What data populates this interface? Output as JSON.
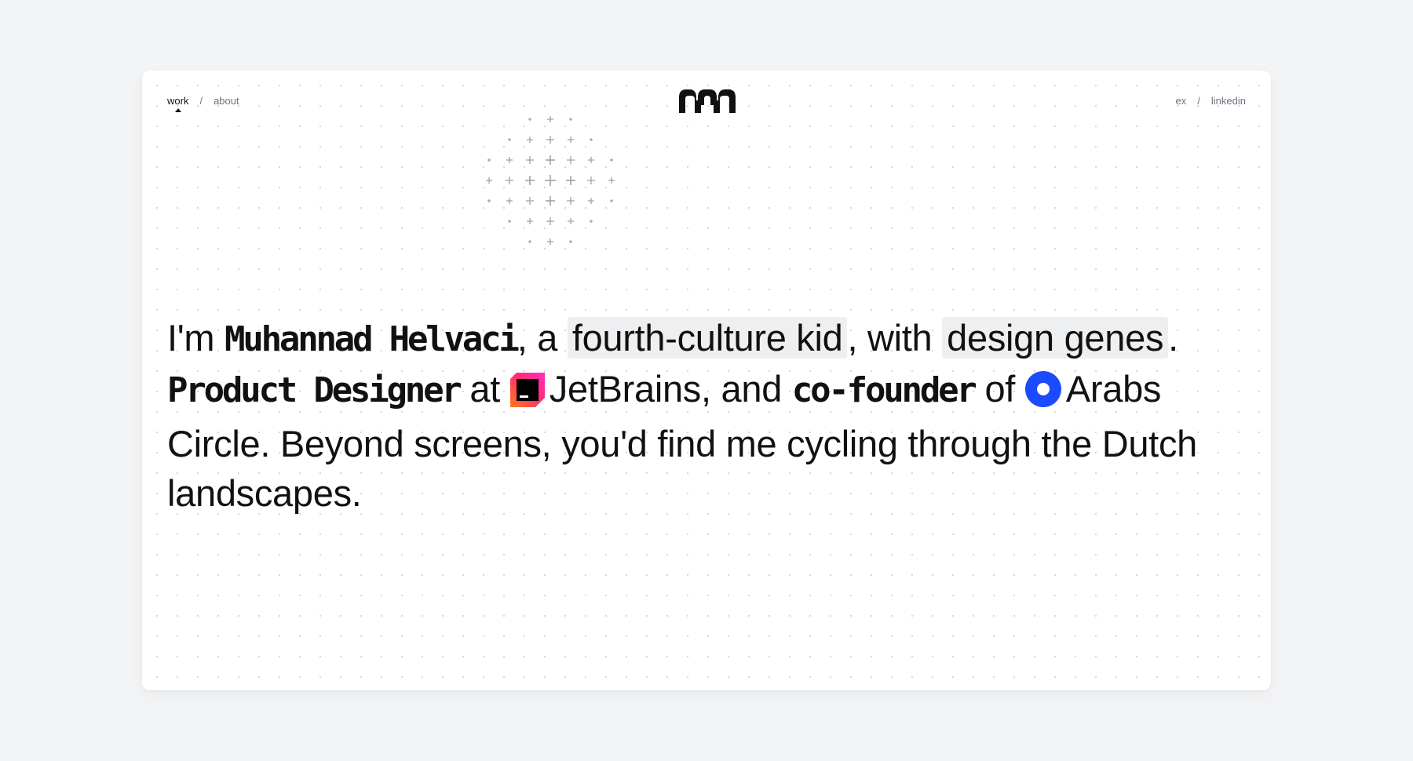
{
  "nav": {
    "left": [
      {
        "label": "work",
        "active": true
      },
      {
        "label": "about",
        "active": false
      }
    ],
    "separator": "/",
    "right": [
      {
        "label": "ex"
      },
      {
        "label": "linkedin"
      }
    ]
  },
  "logo": {
    "icon": "m-logo-icon",
    "color": "#111111"
  },
  "decoration": {
    "icon": "plus-sparkle-icon",
    "color": "#9ca3af"
  },
  "bio": {
    "intro": "I'm ",
    "name": "Muhannad Helvaci",
    "after_name": ", a ",
    "highlight_1": "fourth-culture kid",
    "between_highlights": ", with ",
    "highlight_2": "design genes",
    "after_highlight_2": ". ",
    "role": "Product Designer",
    "at": " at ",
    "company_icon": "jetbrains-logo-icon",
    "company": "JetBrains",
    "and": ", and ",
    "cofounder": "co-founder",
    "of": " of ",
    "org_icon": "arabs-circle-logo-icon",
    "org": "Arabs Circle",
    "rest": ". Beyond screens, you'd find me cycling through the Dutch landscapes."
  },
  "colors": {
    "page_background": "#f3f4f6",
    "card_background": "#ffffff",
    "text": "#111111",
    "muted": "#6b7280",
    "highlight_background": "#eeeff1",
    "arabs_circle_blue": "#1a4bff",
    "jetbrains_pink": "#ff2d8a",
    "jetbrains_orange": "#ff7a1a"
  }
}
